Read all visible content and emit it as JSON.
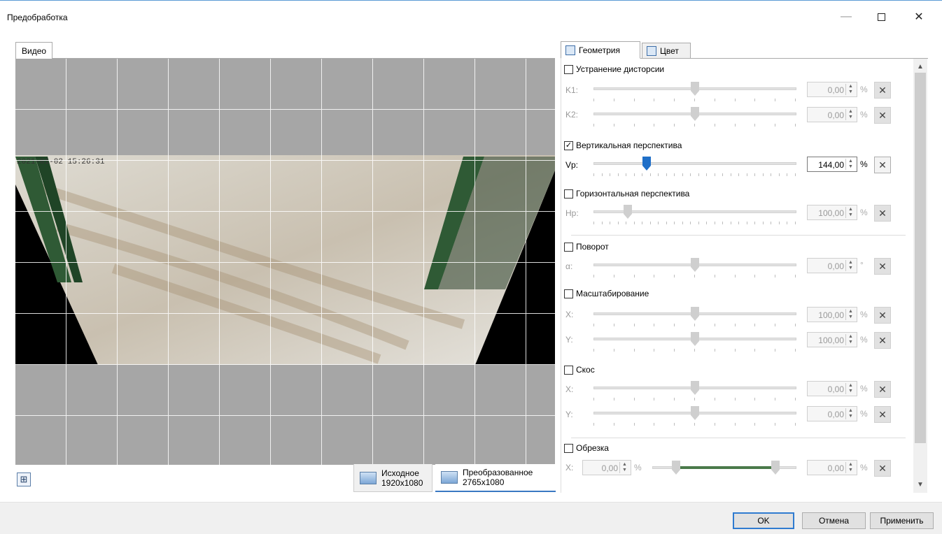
{
  "window": {
    "title": "Предобработка",
    "minimize": "—",
    "close": "✕"
  },
  "left": {
    "tab_label": "Видео",
    "views": [
      {
        "name": "Исходное",
        "size": "1920x1080"
      },
      {
        "name": "Преобразованное",
        "size": "2765x1080"
      }
    ],
    "timestamp_overlay": "2021-01-02 15:26:31 "
  },
  "right": {
    "tabs": [
      "Геометрия",
      "Цвет"
    ],
    "sections": {
      "distortion": {
        "label": "Устранение дисторсии",
        "checked": false,
        "rows": [
          {
            "label": "K1:",
            "value": "0,00",
            "unit": "%"
          },
          {
            "label": "K2:",
            "value": "0,00",
            "unit": "%"
          }
        ]
      },
      "vertical": {
        "label": "Вертикальная перспектива",
        "checked": true,
        "rows": [
          {
            "label": "Vp:",
            "value": "144,00",
            "unit": "%"
          }
        ]
      },
      "horizontal": {
        "label": "Горизонтальная перспектива",
        "checked": false,
        "rows": [
          {
            "label": "Hp:",
            "value": "100,00",
            "unit": "%"
          }
        ]
      },
      "rotation": {
        "label": "Поворот",
        "checked": false,
        "rows": [
          {
            "label": "α:",
            "value": "0,00",
            "unit": "°"
          }
        ]
      },
      "scale": {
        "label": "Масштабирование",
        "checked": false,
        "rows": [
          {
            "label": "X:",
            "value": "100,00",
            "unit": "%"
          },
          {
            "label": "Y:",
            "value": "100,00",
            "unit": "%"
          }
        ]
      },
      "skew": {
        "label": "Скос",
        "checked": false,
        "rows": [
          {
            "label": "X:",
            "value": "0,00",
            "unit": "%"
          },
          {
            "label": "Y:",
            "value": "0,00",
            "unit": "%"
          }
        ]
      },
      "crop": {
        "label": "Обрезка",
        "checked": false,
        "rows": [
          {
            "label": "X:",
            "left_value": "0,00",
            "right_value": "0,00",
            "unit": "%"
          }
        ]
      }
    },
    "x_glyph": "✕"
  },
  "footer": {
    "ok": "OK",
    "cancel": "Отмена",
    "apply": "Применить"
  }
}
